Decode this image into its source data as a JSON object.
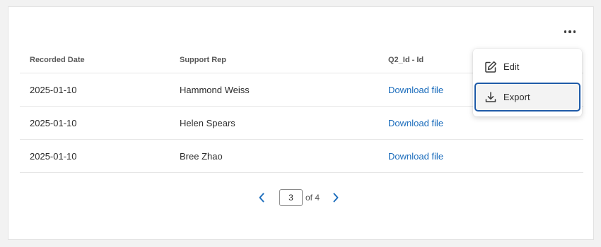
{
  "more_menu": {
    "icon": "more-horizontal-icon",
    "items": [
      {
        "label": "Edit",
        "icon": "edit-icon"
      },
      {
        "label": "Export",
        "icon": "download-icon"
      }
    ]
  },
  "table": {
    "columns": [
      "Recorded Date",
      "Support Rep",
      "Q2_Id - Id"
    ],
    "rows": [
      {
        "recorded_date": "2025-01-10",
        "support_rep": "Hammond Weiss",
        "file_link": "Download file"
      },
      {
        "recorded_date": "2025-01-10",
        "support_rep": "Helen Spears",
        "file_link": "Download file"
      },
      {
        "recorded_date": "2025-01-10",
        "support_rep": "Bree Zhao",
        "file_link": "Download file"
      }
    ]
  },
  "pagination": {
    "current_page": "3",
    "of_label": "of 4",
    "prev_icon": "chevron-left-icon",
    "next_icon": "chevron-right-icon"
  },
  "colors": {
    "link": "#1f6fbd",
    "focus_border": "#1f5ba8"
  }
}
